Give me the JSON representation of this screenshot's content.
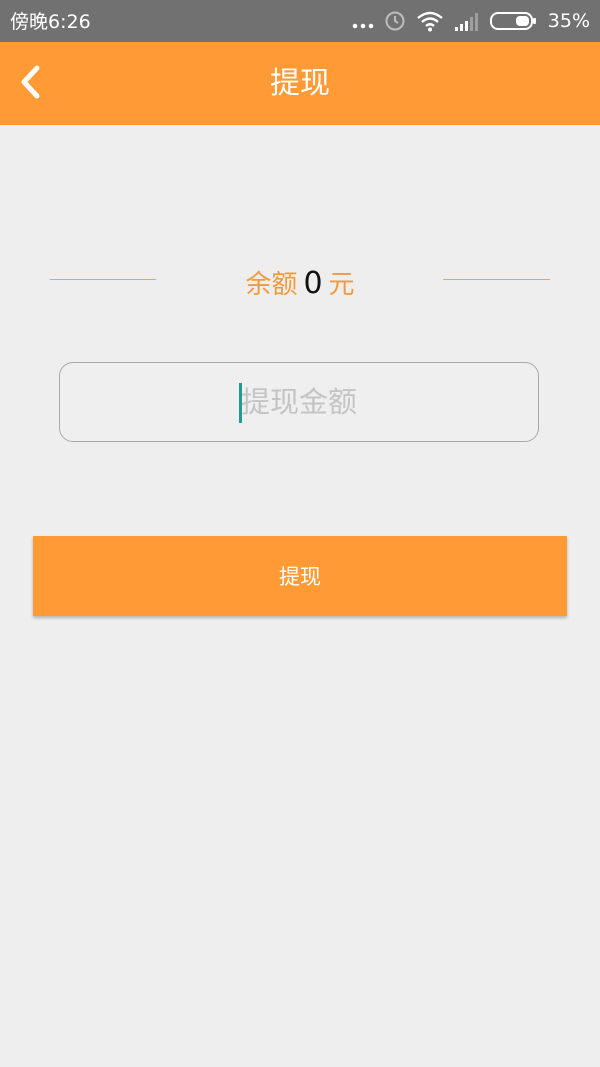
{
  "status_bar": {
    "time": "傍晚6:26",
    "battery": "35%",
    "icons": [
      "more-dots-icon",
      "alarm-icon",
      "wifi-icon",
      "signal-icon",
      "battery-icon"
    ]
  },
  "app_bar": {
    "title": "提现",
    "back_icon": "chevron-left-icon"
  },
  "balance": {
    "label": "余额",
    "value": "0",
    "unit": "元"
  },
  "amount_input": {
    "value": "",
    "placeholder": "提现金额"
  },
  "submit": {
    "label": "提现"
  },
  "colors": {
    "accent": "#ff9a35",
    "balance_text": "#f39a3c",
    "background": "#eeeeee",
    "status_bar": "#717171",
    "cursor": "#1f9b8f"
  }
}
